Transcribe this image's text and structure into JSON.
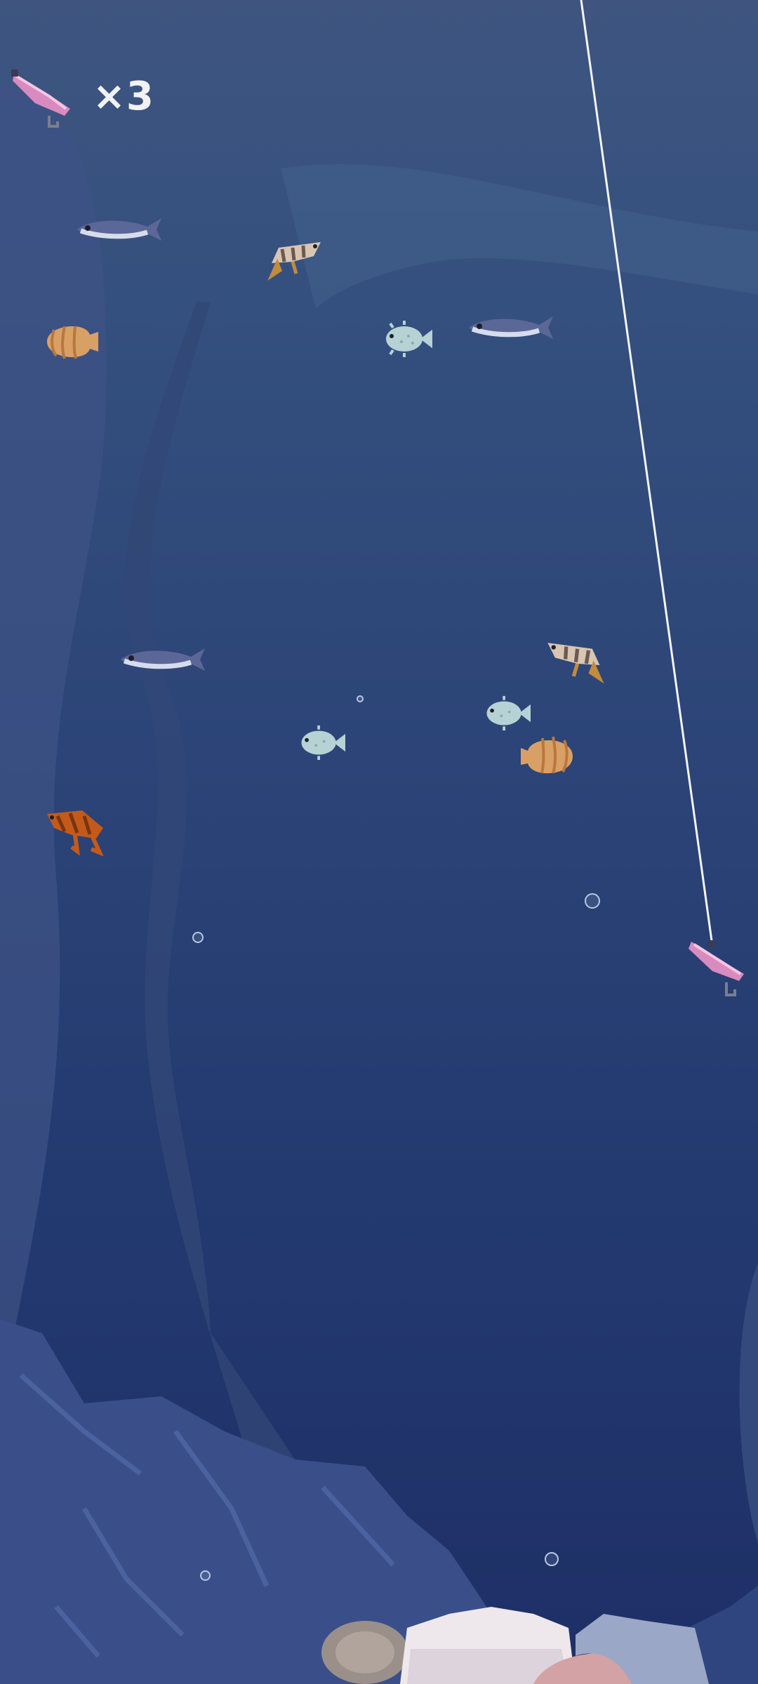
{
  "hud": {
    "bait_icon": "pink-shrimp-bait-icon",
    "bait_count": "×3"
  },
  "colors": {
    "water_top": "#3f5580",
    "water_bottom": "#1e2f66",
    "fishing_line": "#f5f5f5",
    "cave_wall": "#3b4f86",
    "bait_pink": "#d98bbf"
  },
  "sprites": {
    "sardine": "sardine-icon",
    "shrimp": "shrimp-icon",
    "scallop": "scallop-icon",
    "pufferfish": "pufferfish-icon",
    "crab": "crab-icon",
    "coral": "coral-icon",
    "bait": "bait-hook-icon",
    "bubble": "bubble-icon"
  }
}
